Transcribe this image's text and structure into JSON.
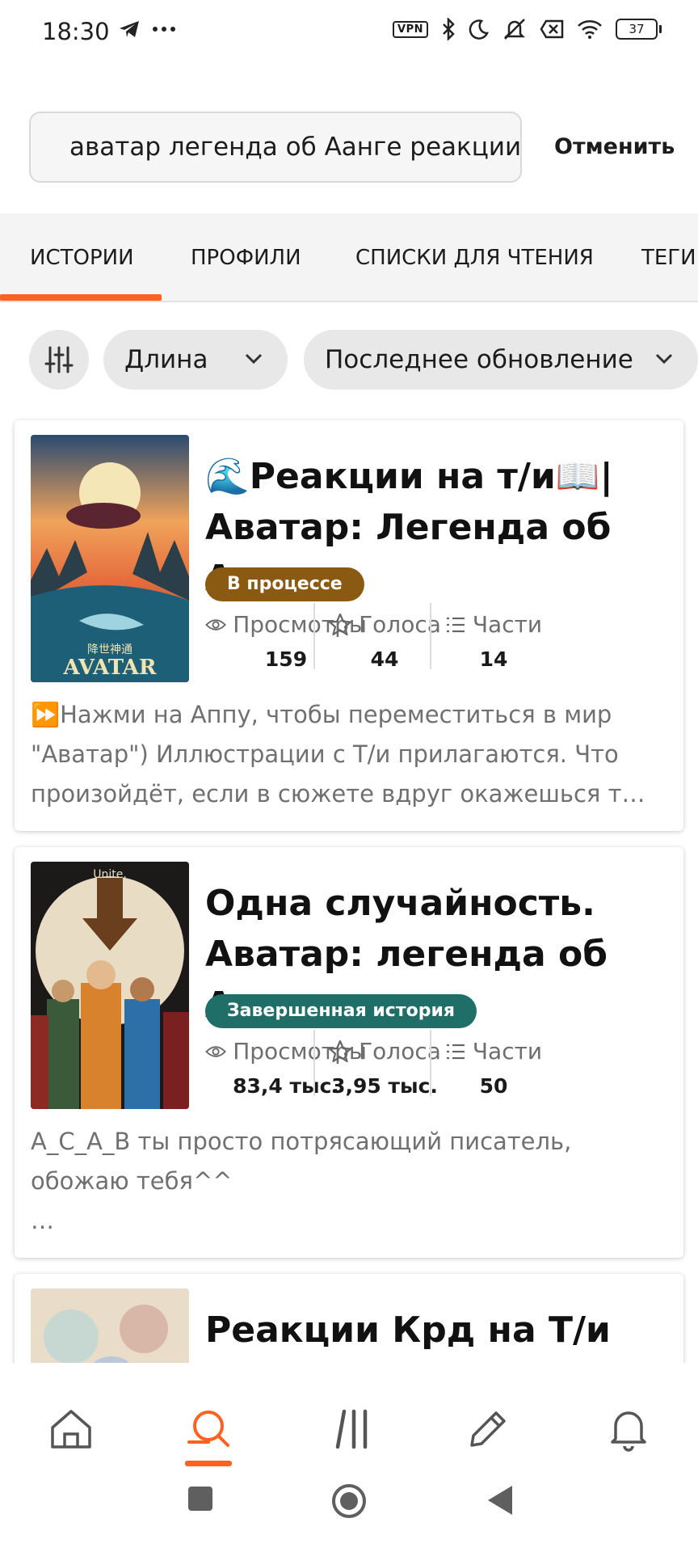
{
  "status_bar": {
    "time": "18:30",
    "vpn": "VPN",
    "battery": "37",
    "icons": [
      "telegram-icon",
      "more-icon",
      "vpn-icon",
      "bluetooth-icon",
      "moon-icon",
      "mute-icon",
      "sim-off-icon",
      "wifi-icon",
      "battery-icon"
    ]
  },
  "search": {
    "query": "аватар легенда об Аанге реакции",
    "cancel_label": "Отменить"
  },
  "tabs": [
    {
      "label": "ИСТОРИИ",
      "active": true
    },
    {
      "label": "ПРОФИЛИ",
      "active": false
    },
    {
      "label": "СПИСКИ ДЛЯ ЧТЕНИЯ",
      "active": false
    },
    {
      "label": "ТЕГИ",
      "active": false
    }
  ],
  "filters": {
    "length_label": "Длина",
    "sort_label": "Последнее обновление"
  },
  "stories": [
    {
      "title_line1": "🌊Реакции на т/и📖|",
      "title_line2": "Аватар: Легенда об Аа…",
      "status": "В процессе",
      "status_color": "#8b5a12",
      "views_label": "Просмотры",
      "views": "159",
      "votes_label": "Голоса",
      "votes": "44",
      "parts_label": "Части",
      "parts": "14",
      "description_line1": "⏩Нажми на Аппу, чтобы переместиться в мир",
      "description_line2": "\"Аватар\") Иллюстрации с Т/и прилагаются. Что",
      "description_line3": "произойдёт, если в сюжете вдруг окажешься т…",
      "cover_text": "AVATAR",
      "cover_subtitle": "降世神通"
    },
    {
      "title_line1": "Одна случайность.",
      "title_line2": "Аватар: легенда об Аанге",
      "status": "Завершенная история",
      "status_color": "#1f6e67",
      "views_label": "Просмотры",
      "views": "83,4 тыс.",
      "votes_label": "Голоса",
      "votes": "3,95 тыс.",
      "parts_label": "Части",
      "parts": "50",
      "description_line1": "А_С_А_В ты просто потрясающий писатель,",
      "description_line2": "обожаю тебя^^",
      "description_line3": "…",
      "cover_text": "Unite."
    },
    {
      "title_line1": "Реакции Крд на Т/и"
    }
  ],
  "bottom_nav": [
    "home-icon",
    "search-icon",
    "library-icon",
    "write-icon",
    "notifications-icon"
  ],
  "colors": {
    "accent": "#ff6122"
  }
}
